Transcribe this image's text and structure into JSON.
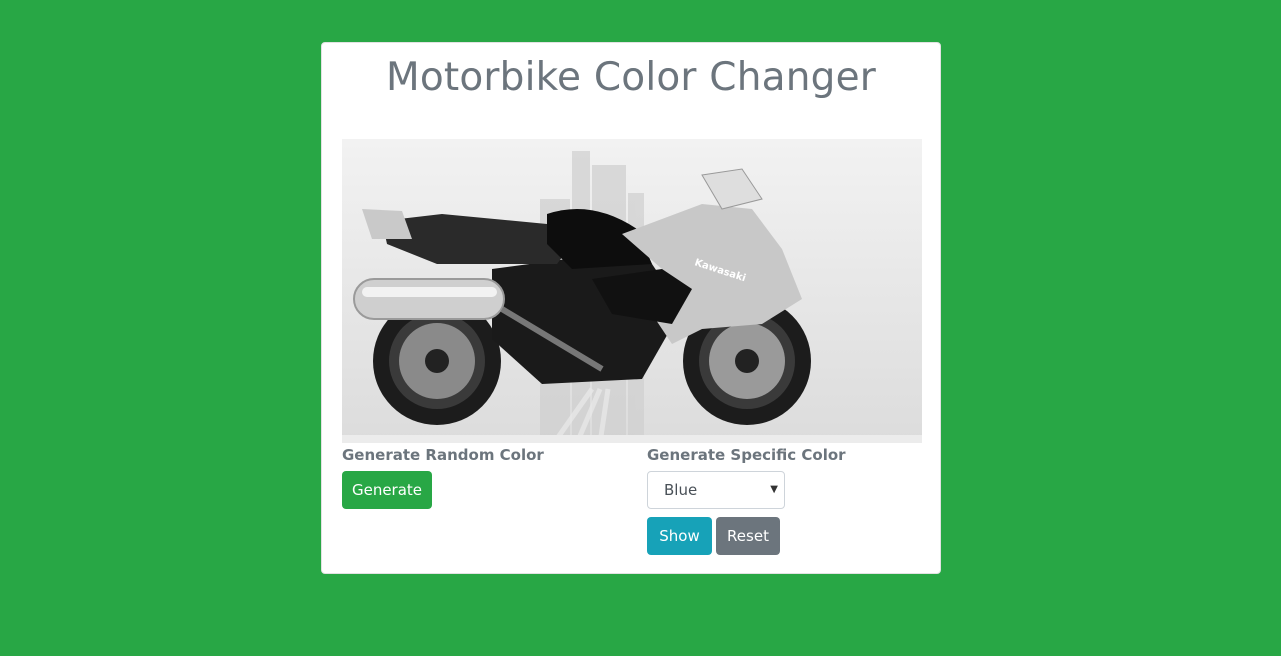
{
  "title": "Motorbike Color Changer",
  "image": {
    "brand_text": "Kawasaki"
  },
  "random_section": {
    "label": "Generate Random Color",
    "button": "Generate"
  },
  "specific_section": {
    "label": "Generate Specific Color",
    "select_value": "Blue",
    "show_button": "Show",
    "reset_button": "Reset"
  },
  "colors": {
    "background": "#28a745",
    "card": "#ffffff",
    "title_text": "#6c757d",
    "generate_button": "#28a745",
    "show_button": "#17a2b8",
    "reset_button": "#6c757d"
  },
  "icons": {
    "select_caret": "caret-down-icon"
  }
}
